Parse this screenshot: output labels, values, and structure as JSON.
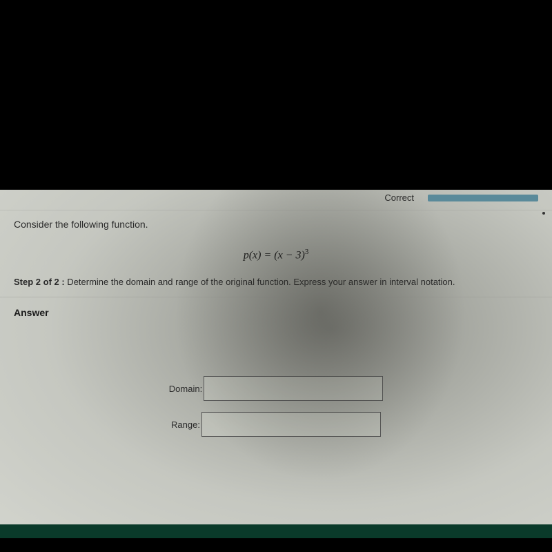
{
  "topbar": {
    "status": "Correct"
  },
  "question": {
    "prompt": "Consider the following function.",
    "equation_lhs": "p(x)",
    "equation_eq": " = ",
    "equation_rhs_base": "(x − 3)",
    "equation_rhs_exp": "3"
  },
  "step": {
    "prefix": "Step 2 of 2 :",
    "text": "  Determine the domain and range of the original function. Express your answer in interval notation."
  },
  "answer": {
    "header": "Answer",
    "domain_label": "Domain:",
    "domain_value": "",
    "range_label": "Range:",
    "range_value": ""
  }
}
